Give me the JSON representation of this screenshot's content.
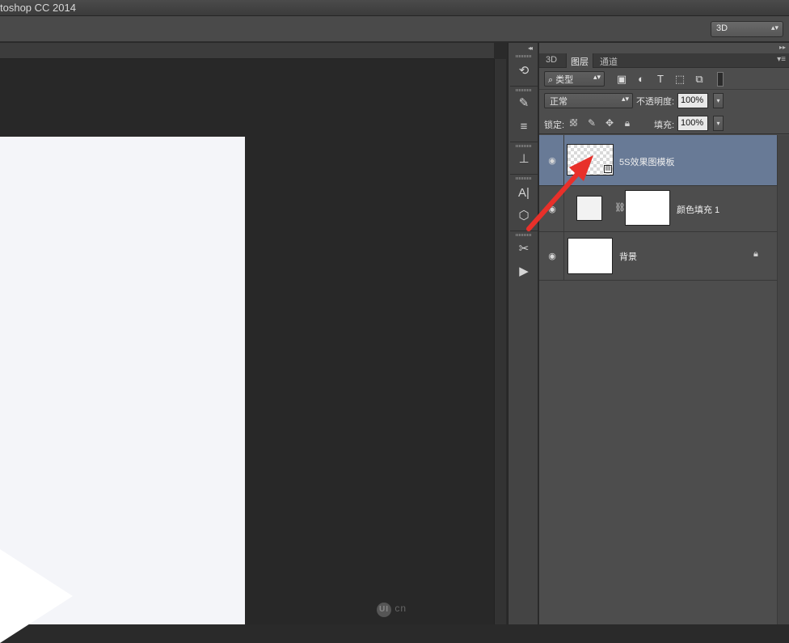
{
  "window": {
    "title": "toshop CC 2014"
  },
  "options_bar": {
    "workspace": "3D"
  },
  "watermark": {
    "logo": "UI",
    "text": "cn"
  },
  "panel": {
    "tabs": [
      {
        "label": "3D"
      },
      {
        "label": "图层"
      },
      {
        "label": "通道"
      }
    ],
    "active_tab": "图层",
    "filter": {
      "kind_label": "类型",
      "icons": [
        "image-filter-icon",
        "adjustment-filter-icon",
        "type-filter-icon",
        "shape-filter-icon",
        "smart-object-filter-icon"
      ]
    },
    "blend_mode": "正常",
    "opacity_label": "不透明度:",
    "opacity_value": "100%",
    "lock_label": "锁定:",
    "fill_label": "填充:",
    "fill_value": "100%"
  },
  "layers": [
    {
      "name": "5S效果图模板",
      "selected": true,
      "type": "smart-object"
    },
    {
      "name": "颜色填充 1",
      "selected": false,
      "type": "fill"
    },
    {
      "name": "背景",
      "selected": false,
      "type": "background",
      "locked": true
    }
  ],
  "annotation": {
    "arrow_color": "#e8302a"
  },
  "colors": {
    "selected_layer": "#687a96",
    "panel_bg": "#4d4d4d",
    "canvas_bg": "#f4f5f9"
  }
}
